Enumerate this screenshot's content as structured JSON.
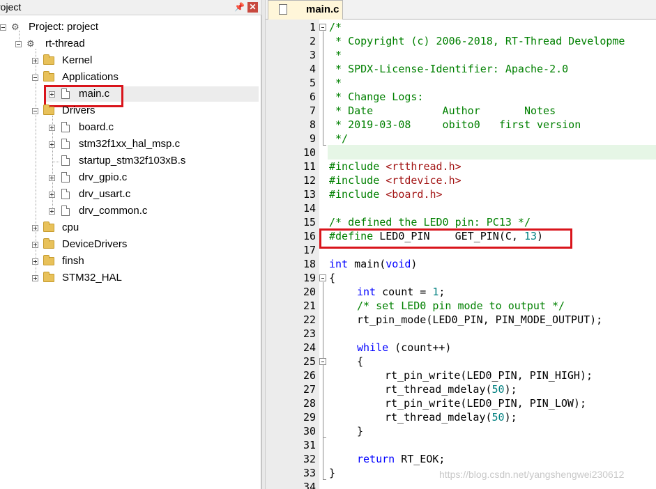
{
  "project_pane": {
    "title": "roject",
    "pin_icon": "pin-icon",
    "close_icon": "close-icon",
    "tree": {
      "root": "Project: project",
      "group": "rt-thread",
      "kernel": "Kernel",
      "applications": "Applications",
      "main_c": "main.c",
      "drivers": "Drivers",
      "board_c": "board.c",
      "stm32_msp": "stm32f1xx_hal_msp.c",
      "startup": "startup_stm32f103xB.s",
      "drv_gpio": "drv_gpio.c",
      "drv_usart": "drv_usart.c",
      "drv_common": "drv_common.c",
      "cpu": "cpu",
      "devicedrivers": "DeviceDrivers",
      "finsh": "finsh",
      "stm32_hal": "STM32_HAL"
    }
  },
  "editor": {
    "tab_label": "main.c",
    "line_numbers": [
      "1",
      "2",
      "3",
      "4",
      "5",
      "6",
      "7",
      "8",
      "9",
      "10",
      "11",
      "12",
      "13",
      "14",
      "15",
      "16",
      "17",
      "18",
      "19",
      "20",
      "21",
      "22",
      "23",
      "24",
      "25",
      "26",
      "27",
      "28",
      "29",
      "30",
      "31",
      "32",
      "33",
      "34"
    ],
    "code": {
      "l1": "/*",
      "l2": " * Copyright (c) 2006-2018, RT-Thread Developme",
      "l3": " *",
      "l4": " * SPDX-License-Identifier: Apache-2.0",
      "l5": " *",
      "l6": " * Change Logs:",
      "l7": " * Date           Author       Notes",
      "l8": " * 2019-03-08     obito0   first version",
      "l9": " */",
      "l11_kw": "#include",
      "l11_hdr": " <rtthread.h>",
      "l12_kw": "#include",
      "l12_hdr": " <rtdevice.h>",
      "l13_kw": "#include",
      "l13_hdr": " <board.h>",
      "l15": "/* defined the LED0 pin: PC13 */",
      "l16_kw": "#define",
      "l16_a": " LED0_PIN    GET_PIN(C, ",
      "l16_num": "13",
      "l16_b": ")",
      "l18_kw": "int",
      "l18_a": " main(",
      "l18_kw2": "void",
      "l18_b": ")",
      "l19": "{",
      "l20_kw": "int",
      "l20_a": " count = ",
      "l20_num": "1",
      "l20_b": ";",
      "l21": "/* set LED0 pin mode to output */",
      "l22": "rt_pin_mode(LED0_PIN, PIN_MODE_OUTPUT);",
      "l24_kw": "while",
      "l24_a": " (count++)",
      "l25": "{",
      "l26": "rt_pin_write(LED0_PIN, PIN_HIGH);",
      "l27_a": "rt_thread_mdelay(",
      "l27_num": "50",
      "l27_b": ");",
      "l28": "rt_pin_write(LED0_PIN, PIN_LOW);",
      "l29_a": "rt_thread_mdelay(",
      "l29_num": "50",
      "l29_b": ");",
      "l30": "}",
      "l32_kw": "return",
      "l32_a": " RT_EOK;",
      "l33": "}"
    }
  },
  "watermark": "https://blog.csdn.net/yangshengwei230612",
  "colors": {
    "comment": "#008000",
    "keyword": "#0000ff",
    "number": "#008080",
    "header": "#a31515",
    "highlight_box": "#d9141b",
    "tab_bg": "#fff6d9"
  }
}
